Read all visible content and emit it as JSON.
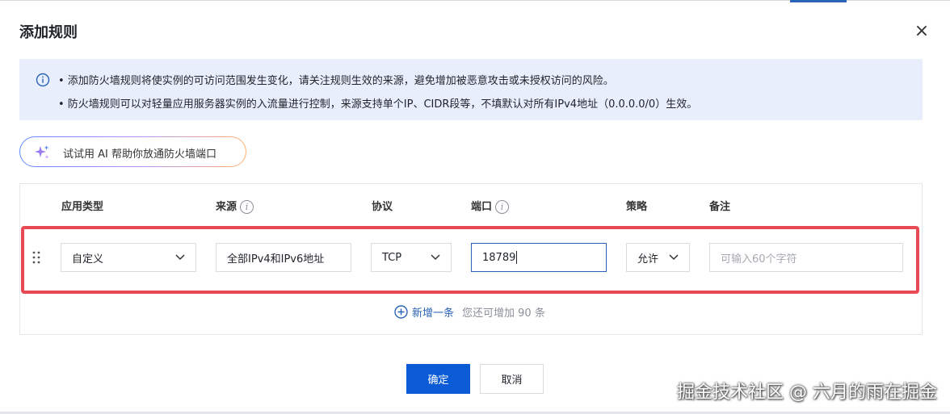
{
  "dialog": {
    "title": "添加规则",
    "close_glyph": "×"
  },
  "notice": {
    "icon": "info-icon",
    "line1": "• 添加防火墙规则将使实例的可访问范围发生变化，请关注规则生效的来源，避免增加被恶意攻击或未授权访问的风险。",
    "line2": "• 防火墙规则可以对轻量应用服务器实例的入流量进行控制，来源支持单个IP、CIDR段等，不填默认对所有IPv4地址（0.0.0.0/0）生效。"
  },
  "ai_button": {
    "icon": "sparkle-icon",
    "label": "试试用 AI 帮助你放通防火墙端口"
  },
  "table": {
    "columns": {
      "app_type": "应用类型",
      "source": "来源",
      "protocol": "协议",
      "port": "端口",
      "policy": "策略",
      "remark": "备注"
    },
    "row": {
      "app_type": "自定义",
      "source": "全部IPv4和IPv6地址",
      "protocol": "TCP",
      "port": "18789",
      "policy": "允许",
      "remark_placeholder": "可输入60个字符"
    }
  },
  "add_row": {
    "label": "新增一条",
    "remaining": "您还可增加 90 条"
  },
  "footer": {
    "confirm": "确定",
    "cancel": "取消"
  },
  "watermark": "掘金技术社区 @ 六月的雨在掘金",
  "colors": {
    "primary": "#0b5ad6",
    "notice_bg": "#e8eefc",
    "highlight": "#e84a55"
  }
}
